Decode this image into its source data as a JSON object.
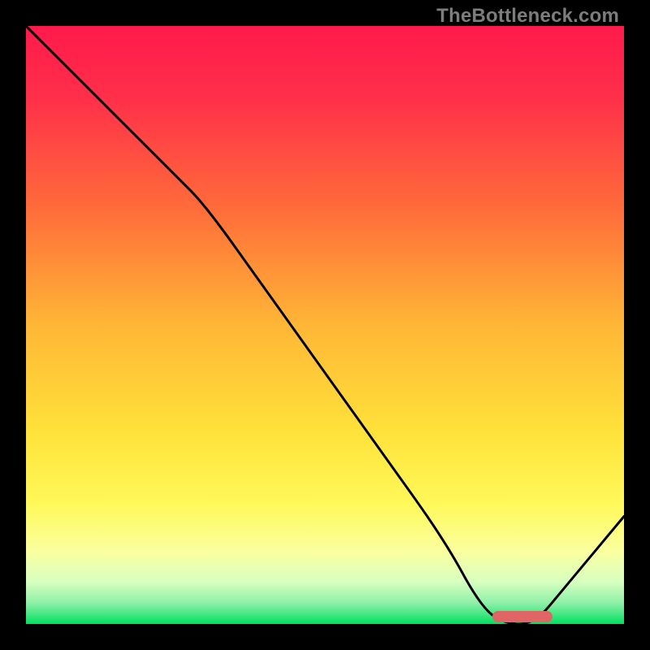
{
  "watermark": "TheBottleneck.com",
  "chart_data": {
    "type": "line",
    "title": "",
    "xlabel": "",
    "ylabel": "",
    "xlim": [
      0,
      100
    ],
    "ylim": [
      0,
      100
    ],
    "series": [
      {
        "name": "bottleneck-curve",
        "x": [
          0,
          10,
          20,
          25,
          30,
          40,
          50,
          60,
          70,
          76,
          80,
          85,
          90,
          100
        ],
        "y": [
          100,
          90,
          80,
          75,
          70,
          56,
          42,
          28,
          14,
          3,
          0,
          0,
          6,
          18
        ]
      }
    ],
    "optimal_range_x": [
      78,
      88
    ],
    "gradient_stops": [
      {
        "offset": 0.0,
        "color": "#ff1a4b"
      },
      {
        "offset": 0.12,
        "color": "#ff2f4a"
      },
      {
        "offset": 0.3,
        "color": "#ff6a3a"
      },
      {
        "offset": 0.5,
        "color": "#ffb636"
      },
      {
        "offset": 0.68,
        "color": "#ffe23a"
      },
      {
        "offset": 0.8,
        "color": "#fff95a"
      },
      {
        "offset": 0.88,
        "color": "#faffa0"
      },
      {
        "offset": 0.93,
        "color": "#d6ffc0"
      },
      {
        "offset": 0.965,
        "color": "#8ef0a8"
      },
      {
        "offset": 1.0,
        "color": "#00e060"
      }
    ]
  }
}
